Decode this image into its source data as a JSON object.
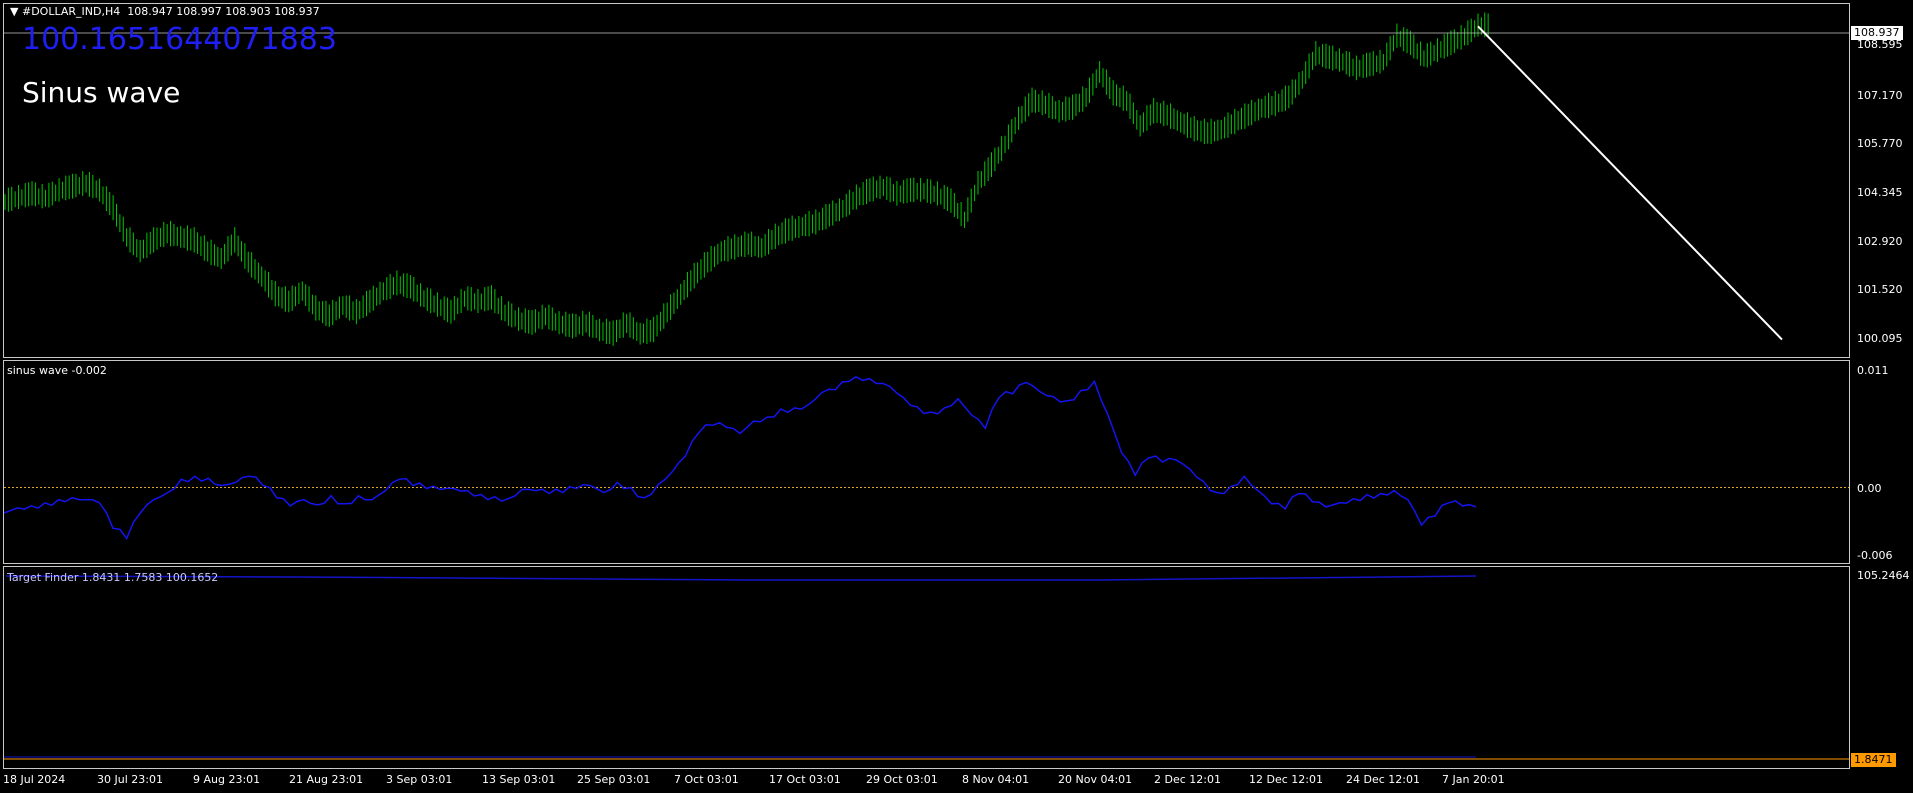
{
  "header": {
    "symbol": "#DOLLAR_IND,H4",
    "ohlc": "108.947 108.997 108.903 108.937",
    "big_value": "100.1651644071883",
    "title": "Sinus wave"
  },
  "sub1": {
    "label": "sinus wave -0.002"
  },
  "sub2": {
    "label": "Target Finder 1.8431 1.7583 100.1652"
  },
  "colors": {
    "candles": "#00c800",
    "projection": "#ffffff",
    "wave": "#1414f0",
    "zero": "#daa520",
    "target": "#1414c8",
    "level": "#ff9900"
  },
  "chart_data": [
    {
      "type": "candlestick",
      "title": "#DOLLAR_IND,H4",
      "y_ticks": [
        "108.595",
        "107.170",
        "105.770",
        "104.345",
        "102.920",
        "101.520",
        "100.095"
      ],
      "ylim": [
        99.65,
        109.55
      ],
      "current_price": "108.937",
      "x_ticks": [
        "18 Jul 2024",
        "30 Jul 23:01",
        "9 Aug 23:01",
        "21 Aug 23:01",
        "3 Sep 03:01",
        "13 Sep 03:01",
        "25 Sep 03:01",
        "7 Oct 03:01",
        "17 Oct 03:01",
        "29 Oct 03:01",
        "8 Nov 04:01",
        "20 Nov 04:01",
        "2 Dec 12:01",
        "12 Dec 12:01",
        "24 Dec 12:01",
        "7 Jan 20:01"
      ],
      "close_series": [
        104.0,
        104.1,
        104.2,
        104.1,
        104.3,
        104.4,
        104.5,
        104.3,
        103.8,
        103.0,
        102.6,
        102.9,
        103.1,
        103.0,
        102.9,
        102.6,
        102.4,
        102.9,
        102.3,
        101.9,
        101.4,
        101.2,
        101.5,
        101.0,
        100.8,
        101.1,
        100.9,
        101.2,
        101.5,
        101.7,
        101.6,
        101.3,
        101.1,
        100.9,
        101.3,
        101.2,
        101.3,
        100.9,
        100.7,
        100.6,
        100.8,
        100.6,
        100.5,
        100.6,
        100.4,
        100.3,
        100.6,
        100.3,
        100.4,
        100.9,
        101.4,
        101.9,
        102.3,
        102.6,
        102.7,
        102.8,
        102.7,
        103.0,
        103.2,
        103.3,
        103.4,
        103.6,
        103.8,
        104.1,
        104.3,
        104.4,
        104.2,
        104.3,
        104.3,
        104.2,
        104.0,
        103.5,
        104.5,
        105.0,
        105.6,
        106.3,
        106.8,
        106.7,
        106.5,
        106.6,
        106.9,
        107.6,
        107.0,
        106.8,
        106.1,
        106.5,
        106.4,
        106.2,
        106.0,
        105.9,
        106.0,
        106.2,
        106.4,
        106.6,
        106.7,
        106.9,
        107.4,
        108.1,
        108.0,
        107.9,
        107.7,
        107.8,
        107.9,
        108.6,
        108.4,
        108.0,
        108.2,
        108.4,
        108.6,
        108.9
      ],
      "projection": {
        "from": 108.9,
        "to": 100.1652
      }
    },
    {
      "type": "line",
      "title": "sinus wave -0.002",
      "y_ticks": [
        "0.011",
        "0.00",
        "-0.006"
      ],
      "ylim": [
        -0.0075,
        0.0125
      ],
      "zero_line": 0.0,
      "values": [
        -0.0025,
        -0.002,
        -0.0018,
        -0.0015,
        -0.0012,
        -0.001,
        -0.0012,
        -0.0015,
        -0.004,
        -0.005,
        -0.0025,
        -0.0012,
        -0.0005,
        0.0008,
        0.0011,
        0.0009,
        0.0002,
        0.0005,
        0.0011,
        0.0002,
        -0.001,
        -0.0018,
        -0.0012,
        -0.0017,
        -0.0008,
        -0.0016,
        -0.0008,
        -0.0012,
        -0.0003,
        0.0008,
        0.0002,
        -0.0001,
        -0.0002,
        -0.0001,
        -0.0003,
        -0.0007,
        -0.0009,
        -0.0011,
        -0.0002,
        -0.0003,
        -0.0006,
        -0.0005,
        -0.0001,
        0.0002,
        -0.0005,
        0.0005,
        0.0,
        -0.001,
        0.0003,
        0.0015,
        0.0031,
        0.0054,
        0.0061,
        0.0059,
        0.0053,
        0.0065,
        0.0069,
        0.0077,
        0.0078,
        0.0081,
        0.0093,
        0.0096,
        0.0104,
        0.0105,
        0.0102,
        0.0099,
        0.0088,
        0.0079,
        0.0074,
        0.0078,
        0.0087,
        0.0071,
        0.0058,
        0.0088,
        0.0092,
        0.0103,
        0.0094,
        0.0089,
        0.0085,
        0.0095,
        0.0104,
        0.0071,
        0.0034,
        0.0012,
        0.0029,
        0.0025,
        0.0027,
        0.0018,
        0.0006,
        -0.0005,
        0.0001,
        0.0011,
        -0.0003,
        -0.0016,
        -0.0021,
        -0.0006,
        -0.0014,
        -0.0019,
        -0.0015,
        -0.0011,
        -0.0007,
        -0.0006,
        -0.0003,
        -0.0012,
        -0.0037,
        -0.0028,
        -0.0015,
        -0.0018,
        -0.0019
      ]
    },
    {
      "type": "line",
      "title": "Target Finder 1.8431 1.7583 100.1652",
      "y_ticks": [
        "105.2464"
      ],
      "level": "1.8471"
    }
  ]
}
